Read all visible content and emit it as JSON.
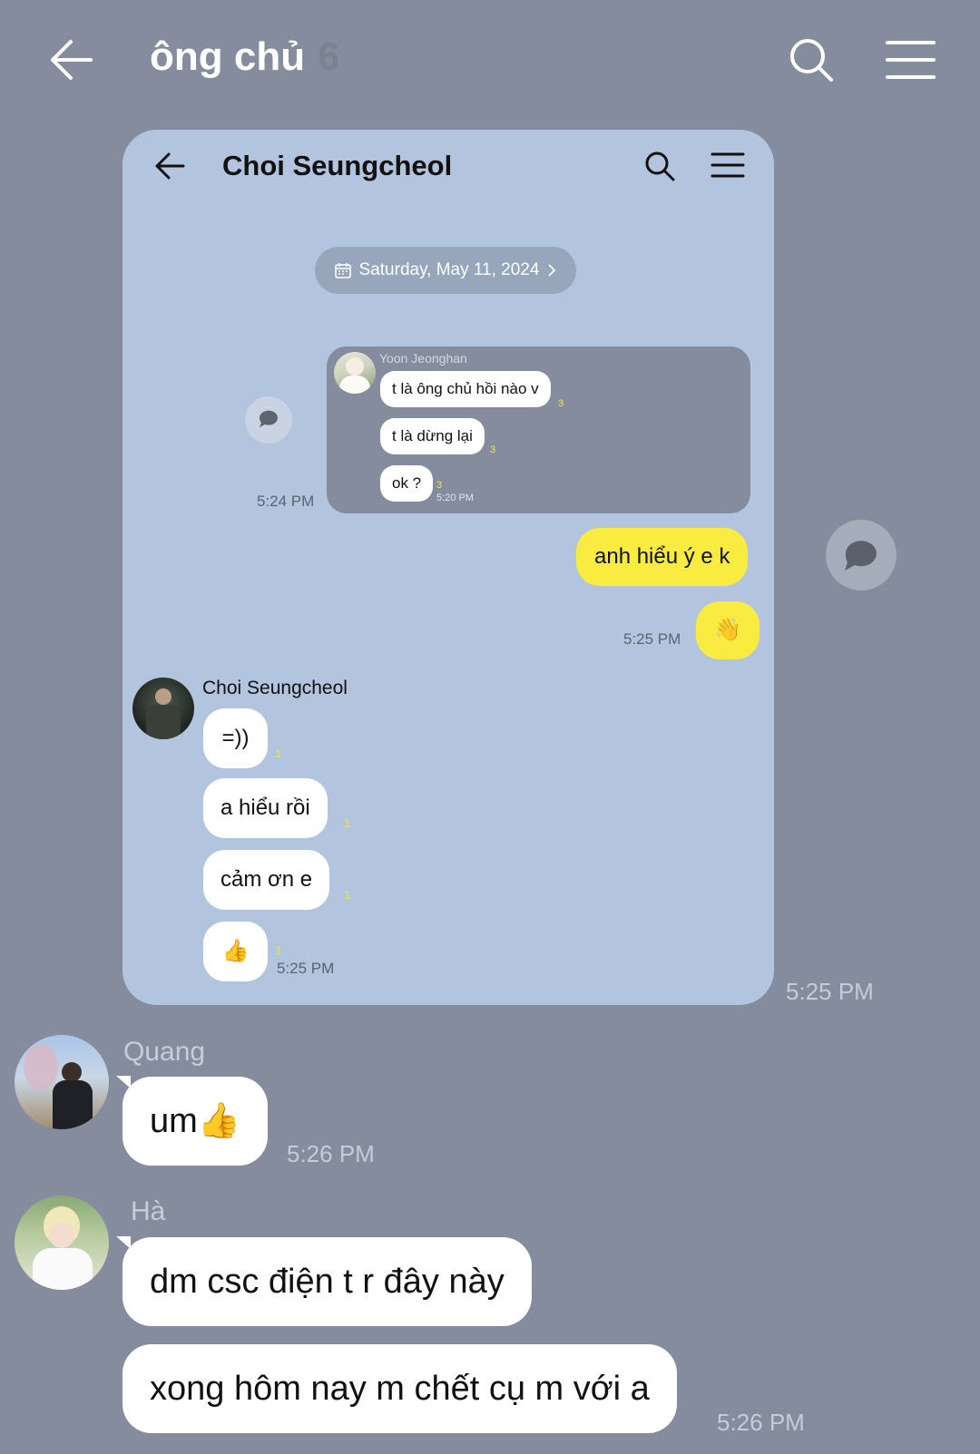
{
  "header": {
    "title": "ông chủ",
    "member_count": "6",
    "icons": [
      "back-arrow-icon",
      "search-icon",
      "menu-icon"
    ]
  },
  "shared_image": {
    "chat_title": "Choi Seungcheol",
    "date_label": "Saturday, May 11, 2024",
    "quoted": {
      "sender": "Yoon Jeonghan",
      "messages": [
        {
          "text": "t là ông chủ hồi nào v",
          "read": "3"
        },
        {
          "text": "t là dừng lại",
          "read": "3"
        },
        {
          "text": "ok ?",
          "read": "3",
          "time": "5:20 PM"
        }
      ],
      "shared_time": "5:24 PM"
    },
    "my_messages": {
      "text": "anh hiểu ý e k",
      "sticker": "👋",
      "time": "5:25 PM"
    },
    "reply": {
      "sender": "Choi Seungcheol",
      "messages": [
        {
          "text": "=))",
          "read": "1"
        },
        {
          "text": "a hiểu rồi",
          "read": "1"
        },
        {
          "text": "cảm ơn e",
          "read": "1"
        },
        {
          "text": "👍",
          "read": "1",
          "time": "5:25 PM"
        }
      ]
    }
  },
  "shared_image_time": "5:25 PM",
  "messages": [
    {
      "sender": "Quang",
      "texts": [
        "um👍"
      ],
      "time": "5:26 PM"
    },
    {
      "sender": "Hà",
      "texts": [
        "dm csc điện t r đây này",
        "xong hôm nay m chết cụ m với a"
      ],
      "time": "5:26 PM"
    }
  ],
  "colors": {
    "background": "#848c9e",
    "card": "#b3c4de",
    "my_bubble": "#f9eb3f",
    "other_bubble": "#ffffff"
  }
}
